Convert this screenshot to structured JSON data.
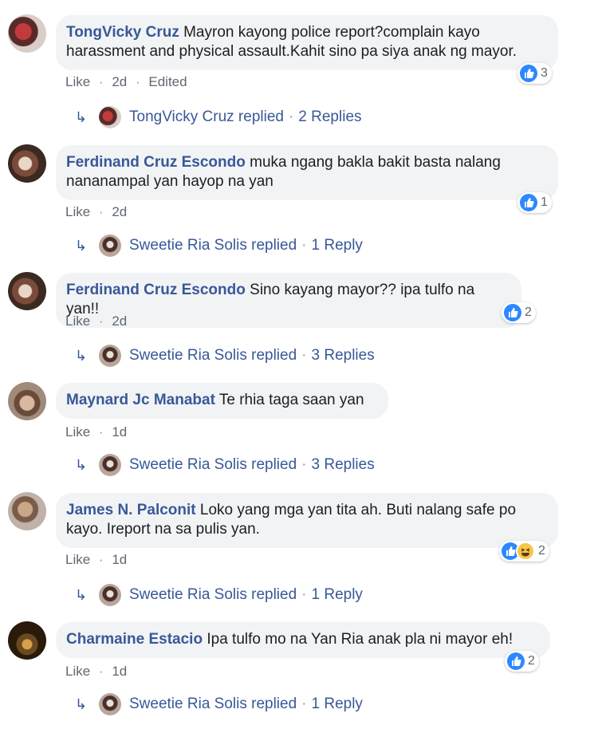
{
  "colors": {
    "link": "#385898",
    "bubble": "#f2f3f5",
    "meta": "#606770",
    "like_blue": "#2d88ff"
  },
  "comments": [
    {
      "author": "TongVicky Cruz",
      "text_line1": "Mayron kayong police report?complain kayo",
      "text_line2": "harassment and physical assault.Kahit sino pa siya anak ng mayor.",
      "like": "Like",
      "time": "2d",
      "edited": "Edited",
      "reaction_count": "3",
      "reply": {
        "name": "TongVicky Cruz replied",
        "count": "2 Replies"
      }
    },
    {
      "author": "Ferdinand Cruz Escondo",
      "text_line1": "muka ngang bakla bakit basta nalang",
      "text_line2": "nananampal yan hayop na yan",
      "like": "Like",
      "time": "2d",
      "reaction_count": "1",
      "reply": {
        "name": "Sweetie Ria Solis replied",
        "count": "1 Reply"
      }
    },
    {
      "author": "Ferdinand Cruz Escondo",
      "text_line1": "Sino kayang mayor?? ipa tulfo na yan!!",
      "like": "Like",
      "time": "2d",
      "reaction_count": "2",
      "reply": {
        "name": "Sweetie Ria Solis replied",
        "count": "3 Replies"
      }
    },
    {
      "author": "Maynard Jc Manabat",
      "text_line1": "Te rhia taga saan yan",
      "like": "Like",
      "time": "1d",
      "reply": {
        "name": "Sweetie Ria Solis replied",
        "count": "3 Replies"
      }
    },
    {
      "author": "James N. Palconit",
      "text_line1": "Loko yang mga yan tita ah. Buti nalang safe po",
      "text_line2": "kayo. Ireport na sa pulis yan.",
      "like": "Like",
      "time": "1d",
      "reaction_count": "2",
      "reply": {
        "name": "Sweetie Ria Solis replied",
        "count": "1 Reply"
      }
    },
    {
      "author": "Charmaine Estacio",
      "text_line1": "Ipa tulfo mo na Yan Ria anak pla ni mayor eh!",
      "like": "Like",
      "time": "1d",
      "reaction_count": "2",
      "reply": {
        "name": "Sweetie Ria Solis replied",
        "count": "1 Reply"
      }
    }
  ],
  "separator": "·"
}
